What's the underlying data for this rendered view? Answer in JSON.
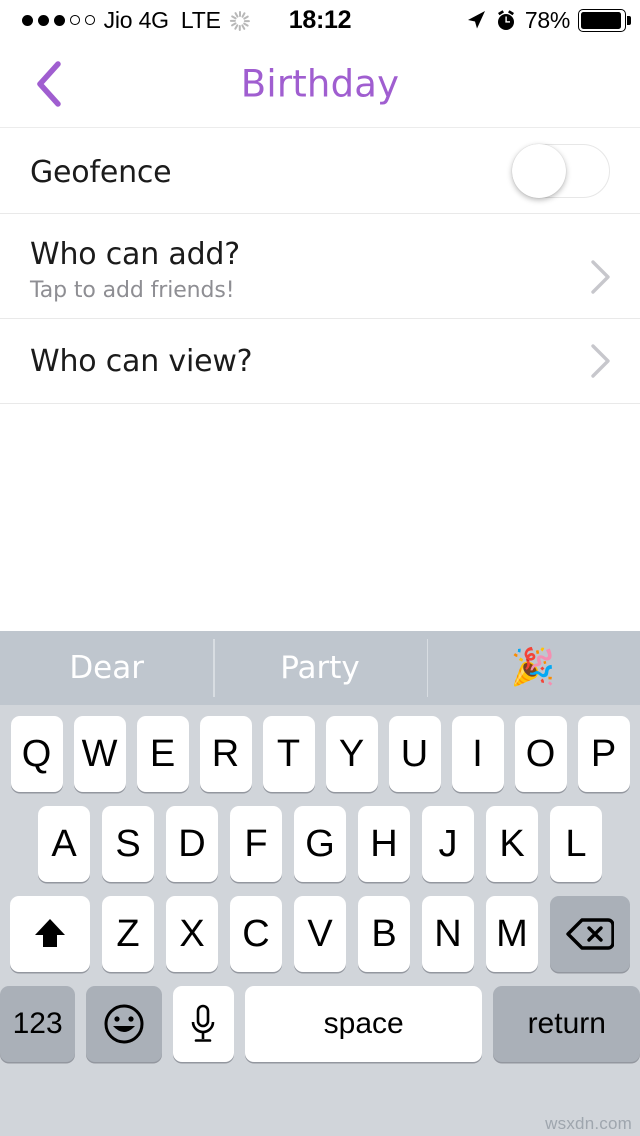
{
  "status_bar": {
    "signal_dots_filled": 3,
    "signal_dots_empty": 2,
    "carrier": "Jio 4G",
    "network": "LTE",
    "spinner": "activity-spinner",
    "time": "18:12",
    "location_icon": "location-arrow-icon",
    "alarm_icon": "alarm-clock-icon",
    "battery_percent": "78%",
    "battery_level": 78
  },
  "nav": {
    "back_icon": "chevron-left-icon",
    "title": "Birthday",
    "accent_color": "#a05ed0"
  },
  "settings": {
    "geofence": {
      "label": "Geofence",
      "toggle_on": false,
      "toggle_name": "geofence-toggle"
    },
    "who_can_add": {
      "label": "Who can add?",
      "subtitle": "Tap to add friends!",
      "chevron": "chevron-right-icon"
    },
    "who_can_view": {
      "label": "Who can view?",
      "chevron": "chevron-right-icon"
    }
  },
  "keyboard": {
    "predictive": [
      {
        "text": "Dear",
        "type": "word"
      },
      {
        "text": "Party",
        "type": "word"
      },
      {
        "text": "🎉",
        "type": "emoji"
      }
    ],
    "row1": [
      "Q",
      "W",
      "E",
      "R",
      "T",
      "Y",
      "U",
      "I",
      "O",
      "P"
    ],
    "row2": [
      "A",
      "S",
      "D",
      "F",
      "G",
      "H",
      "J",
      "K",
      "L"
    ],
    "row3": [
      "Z",
      "X",
      "C",
      "V",
      "B",
      "N",
      "M"
    ],
    "shift": {
      "icon": "shift-arrow-icon",
      "active": true
    },
    "backspace": {
      "icon": "backspace-delete-icon"
    },
    "numbers_key": "123",
    "emoji_key": {
      "icon": "smiley-face-icon"
    },
    "mic_key": {
      "icon": "microphone-icon"
    },
    "space_key": "space",
    "return_key": "return",
    "background_color": "#d1d5da",
    "predictive_background_color": "#bfc6ce"
  },
  "watermark": "wsxdn.com"
}
